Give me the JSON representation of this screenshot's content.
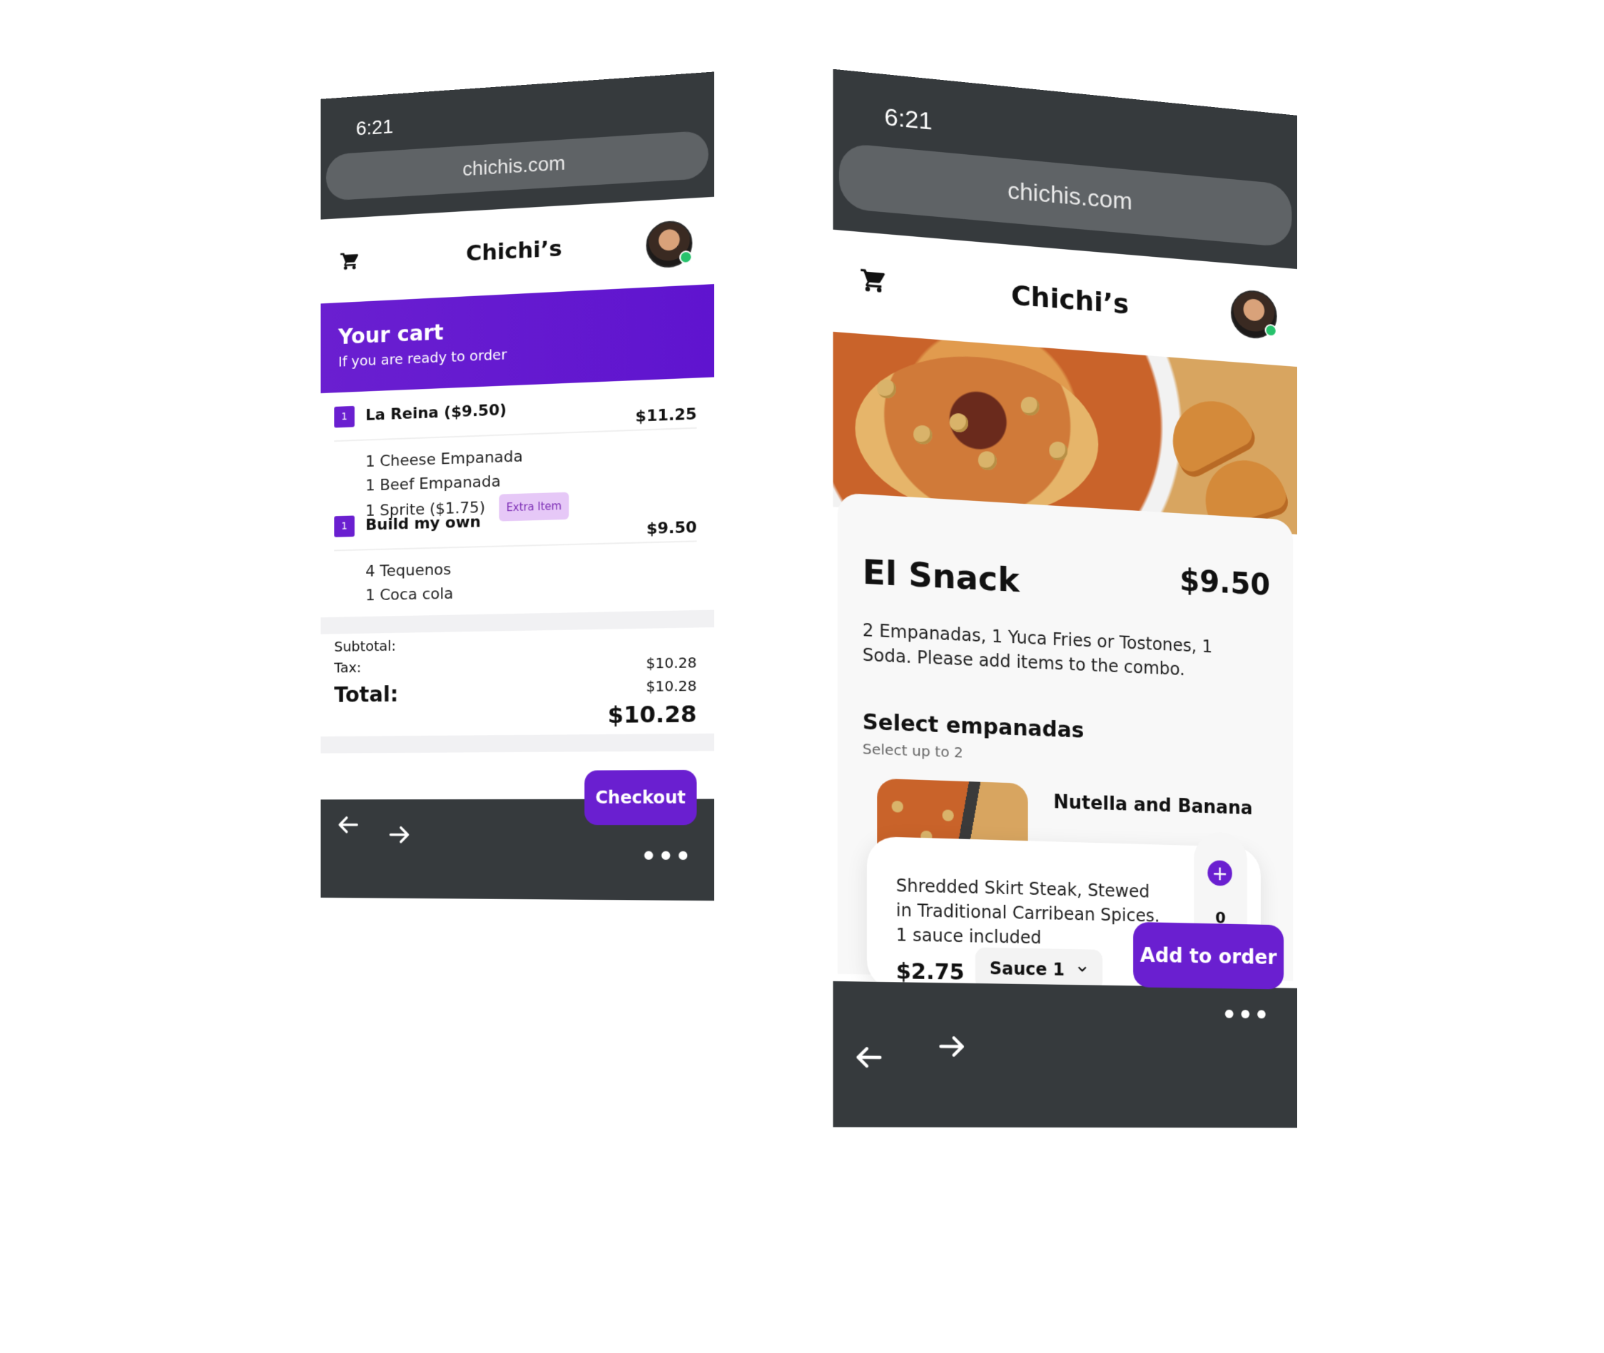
{
  "left_phone": {
    "time": "6:21",
    "url": "chichis.com",
    "brand": "Chichi’s",
    "cart_title": "Your cart",
    "cart_subtitle": "If you are ready to order",
    "orders": [
      {
        "qty": "1",
        "name": "La Reina ($9.50)",
        "price": "$11.25",
        "lines": [
          "1 Cheese Empanada",
          "1 Beef Empanada",
          "1 Sprite ($1.75)"
        ],
        "extra_tag": "Extra Item"
      },
      {
        "qty": "1",
        "name": "Build my own",
        "price": "$9.50",
        "lines": [
          "4 Tequenos",
          "1 Coca cola"
        ]
      }
    ],
    "totals": {
      "subtotal_label": "Subtotal:",
      "tax_label": "Tax:",
      "total_label": "Total:",
      "subtotal_value": "$10.28",
      "tax_value": "$10.28",
      "total_value": "$10.28"
    },
    "checkout_label": "Checkout",
    "more": "•••"
  },
  "right_phone": {
    "time": "6:21",
    "url": "chichis.com",
    "brand": "Chichi’s",
    "dish_name": "El Snack",
    "dish_price": "$9.50",
    "dish_desc": "2 Empanadas, 1 Yuca Fries or Tostones, 1 Soda. Please add items to the combo.",
    "section_title": "Select empanadas",
    "section_sub": "Select up to 2",
    "item_name": "Nutella and Banana",
    "item_ingredients": "Shredded Skirt Steak, Stewed in Traditional Carribean Spices. 1 sauce included",
    "item_price": "$2.75",
    "sauce_label": "Sauce 1",
    "stepper_count": "0",
    "add_label": "Add to order",
    "more": "•••"
  },
  "colors": {
    "accent": "#6a1fd0",
    "browser_chrome": "#363a3d",
    "url_pill": "#5f6366",
    "tag_bg": "#e6c8f7"
  }
}
